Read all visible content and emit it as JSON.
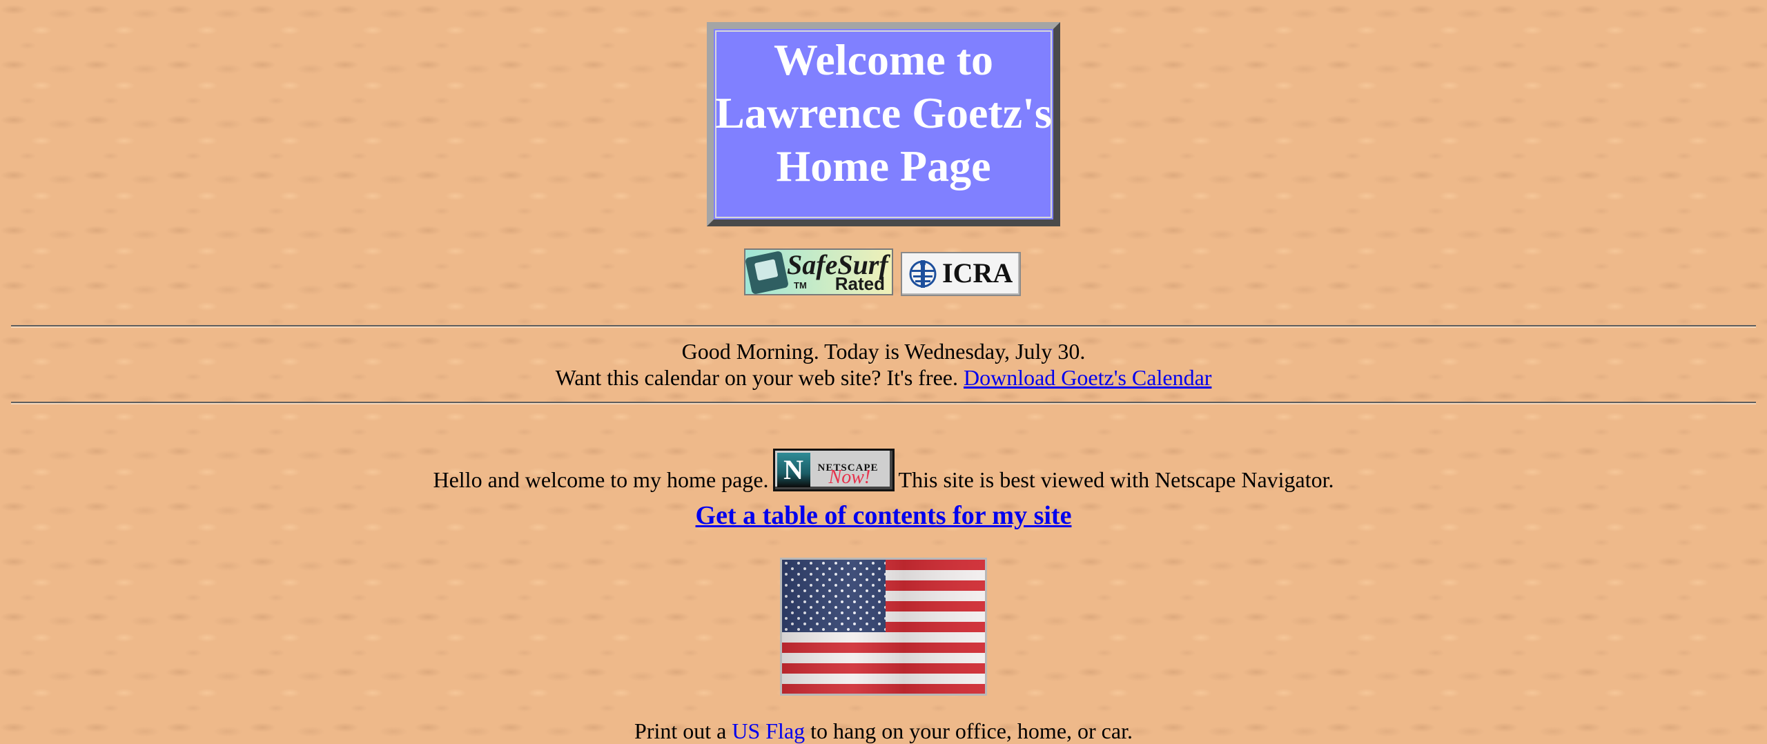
{
  "banner": {
    "lines": [
      "Welcome to",
      "Lawrence Goetz's",
      "Home Page"
    ]
  },
  "badges": {
    "safesurf": {
      "word": "SafeSurf",
      "tm": "TM",
      "rated": "Rated"
    },
    "icra": {
      "word": "ICRA"
    },
    "netscape": {
      "word": "NETSCAPE",
      "now": "Now!"
    }
  },
  "calendar": {
    "greeting": "Good Morning. Today is Wednesday, July 30.",
    "offer_text": "Want this calendar on your web site? It's free. ",
    "download_link": "Download Goetz's Calendar"
  },
  "intro": {
    "hello": "Hello and welcome to my home page.",
    "best_viewed": "This site is best viewed with Netscape Navigator."
  },
  "toc_link": "Get a table of contents for my site",
  "flag_section": {
    "prefix": "Print out a ",
    "link": "US Flag",
    "suffix": " to hang on your office, home, or car."
  },
  "colors": {
    "background": "#eeb98a",
    "banner": "#8080ff",
    "link": "#0000ee"
  }
}
